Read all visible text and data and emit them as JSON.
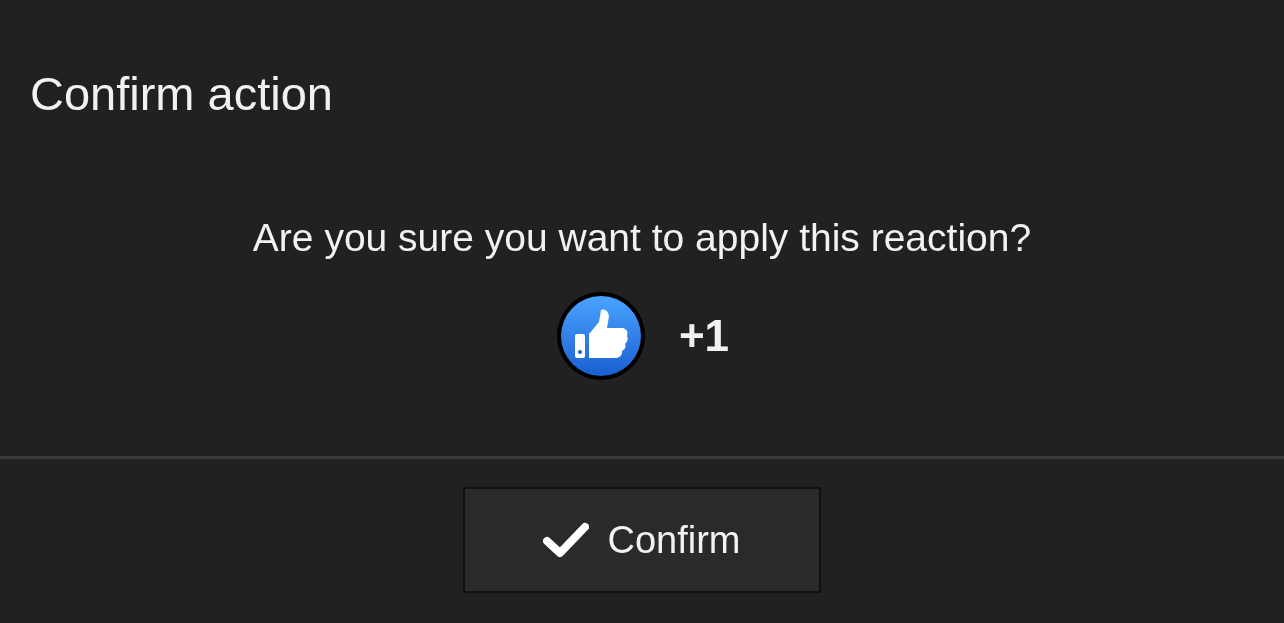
{
  "dialog": {
    "title": "Confirm action",
    "message": "Are you sure you want to apply this reaction?",
    "reaction": {
      "label": "+1"
    },
    "buttons": [
      {
        "label": "Confirm"
      }
    ]
  }
}
